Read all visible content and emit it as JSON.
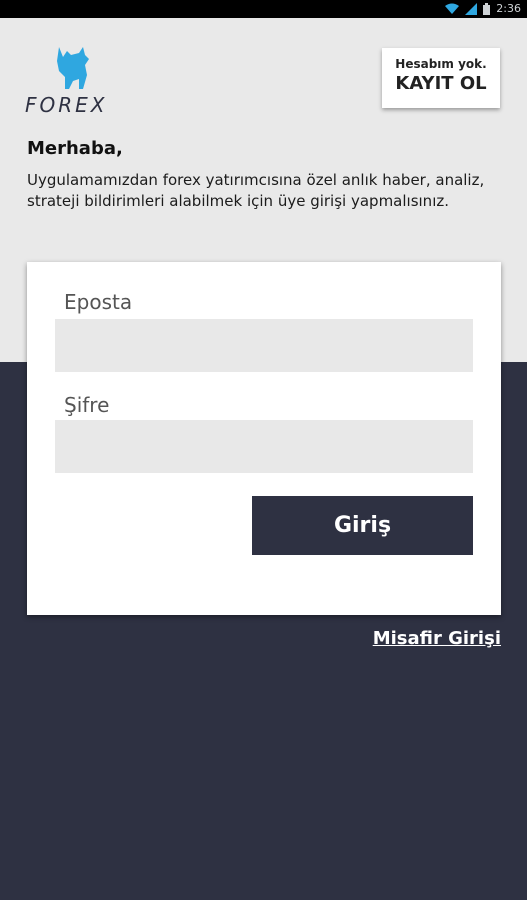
{
  "status_bar": {
    "time": "2:36",
    "icons": [
      "wifi-icon",
      "signal-icon",
      "battery-icon"
    ]
  },
  "logo": {
    "text": "FOREX",
    "icon": "bull-icon",
    "color": "#2fa7e0"
  },
  "register": {
    "prompt": "Hesabım yok.",
    "action": "KAYIT OL"
  },
  "welcome": {
    "greeting": "Merhaba,",
    "message": "Uygulamamızdan forex yatırımcısına özel anlık haber, analiz, strateji bildirimleri alabilmek için üye girişi yapmalısınız."
  },
  "login_form": {
    "email_label": "Eposta",
    "email_value": "",
    "password_label": "Şifre",
    "password_value": "",
    "submit_label": "Giriş"
  },
  "guest_login": "Misafir Girişi",
  "colors": {
    "primary_dark": "#2e3142",
    "top_background": "#e9e9e9",
    "input_background": "#e8e8e8",
    "logo_blue": "#2fa7e0"
  }
}
